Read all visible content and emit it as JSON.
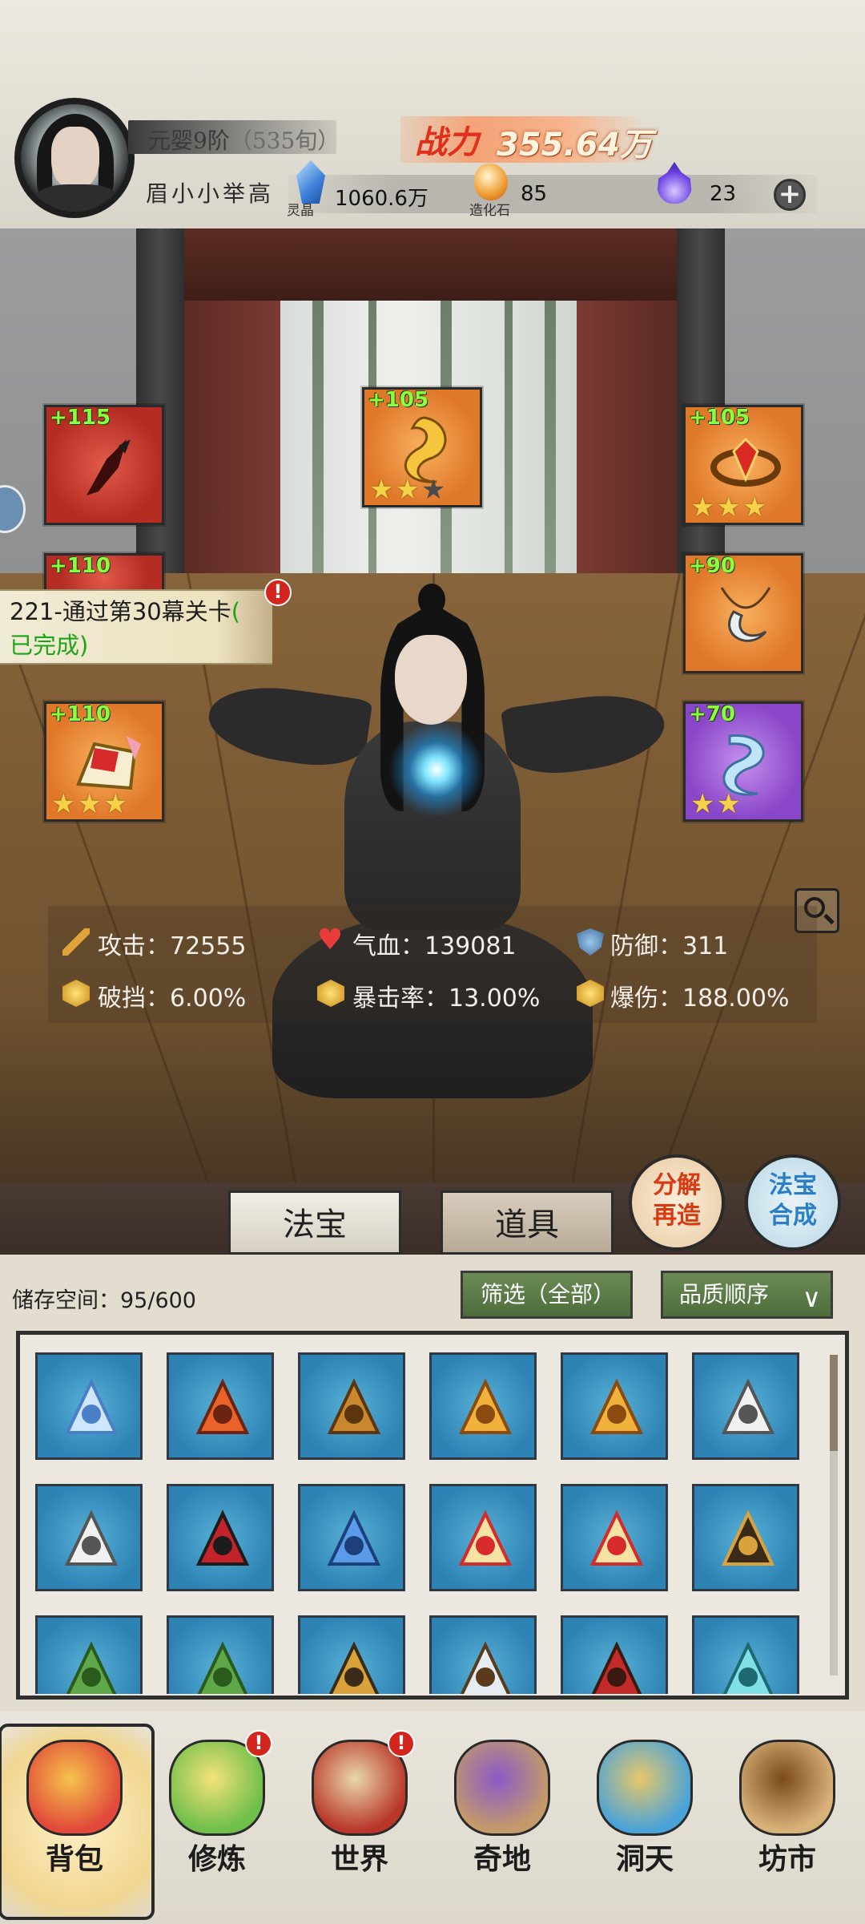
{
  "header": {
    "realm": "元婴9阶",
    "age": "（535旬）",
    "player_name": "眉小小举高",
    "power_label": "战力",
    "power_value": "355.64万",
    "resources": [
      {
        "icon": "spirit-crystal-icon",
        "caption": "灵晶",
        "value": "1060.6万"
      },
      {
        "icon": "creation-stone-icon",
        "caption": "造化石",
        "value": "85"
      },
      {
        "icon": "purple-flame-icon",
        "caption": "",
        "value": "23"
      }
    ],
    "plus_label": "+"
  },
  "equipment": {
    "slots": [
      {
        "level": "+115",
        "stars": 0,
        "max_stars": 0,
        "color": "#c23a2e"
      },
      {
        "level": "+105",
        "stars": 2,
        "max_stars": 3,
        "color": "#e58a35"
      },
      {
        "level": "+105",
        "stars": 3,
        "max_stars": 3,
        "color": "#e58a35"
      },
      {
        "level": "+110",
        "stars": 0,
        "max_stars": 0,
        "color": "#c23a2e"
      },
      {
        "level": "+90",
        "stars": 0,
        "max_stars": 0,
        "color": "#e58a35"
      },
      {
        "level": "+110",
        "stars": 3,
        "max_stars": 3,
        "color": "#e58a35"
      },
      {
        "level": "+70",
        "stars": 2,
        "max_stars": 2,
        "color": "#9a55d2"
      }
    ]
  },
  "quest": {
    "title": "221-通过第30幕关卡",
    "open_paren": "(",
    "status": "已完成)",
    "alert": "!"
  },
  "stats": {
    "attack": "攻击：72555",
    "hp": "气血：139081",
    "defense": "防御：311",
    "break_block": "破挡：6.00%",
    "crit_rate": "暴击率：13.00%",
    "crit_damage": "爆伤：188.00%"
  },
  "side_buttons": {
    "decompose": [
      "分解",
      "再造"
    ],
    "synth": [
      "法宝",
      "合成"
    ]
  },
  "tabs": {
    "treasure": "法宝",
    "items": "道具"
  },
  "inventory": {
    "storage_label": "储存空间：95/600",
    "filter_label": "筛选（全部）",
    "sort_label": "品质顺序",
    "sort_chevron": "∨",
    "items": [
      "ice-sword-icon",
      "fire-axe-icon",
      "bronze-staff-icon",
      "golden-armor-icon",
      "golden-armor-icon",
      "white-robe-icon",
      "white-robe-icon",
      "red-black-boots-icon",
      "blue-boots-icon",
      "golden-boots-icon",
      "golden-boots-icon",
      "dark-hairpin-icon",
      "leaf-wreath-icon",
      "leaf-wreath-icon",
      "horned-crown-icon",
      "silver-pendant-icon",
      "bead-necklace-icon",
      "jade-necklace-icon"
    ]
  },
  "nav": {
    "items": [
      {
        "label": "背包",
        "icon": "bag-icon",
        "alert": ""
      },
      {
        "label": "修炼",
        "icon": "lotus-icon",
        "alert": "!"
      },
      {
        "label": "世界",
        "icon": "scroll-map-icon",
        "alert": "!"
      },
      {
        "label": "奇地",
        "icon": "pagoda-icon",
        "alert": ""
      },
      {
        "label": "洞天",
        "icon": "portal-icon",
        "alert": ""
      },
      {
        "label": "坊市",
        "icon": "market-icon",
        "alert": ""
      }
    ]
  }
}
